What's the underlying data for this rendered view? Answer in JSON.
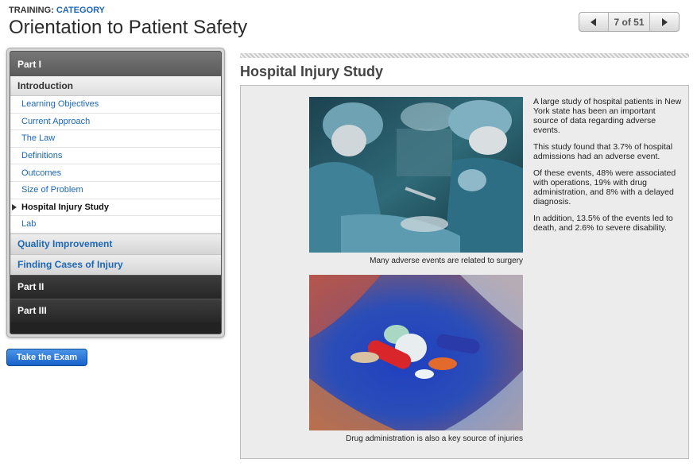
{
  "header": {
    "training_label": "TRAINING:",
    "category_label": "CATEGORY",
    "title": "Orientation to Patient Safety"
  },
  "pager": {
    "count": "7 of 51",
    "prev_icon": "triangle-left-icon",
    "next_icon": "triangle-right-icon"
  },
  "nav": {
    "part1": "Part I",
    "section": "Introduction",
    "items": [
      {
        "label": "Learning Objectives"
      },
      {
        "label": "Current Approach"
      },
      {
        "label": "The Law"
      },
      {
        "label": "Definitions"
      },
      {
        "label": "Outcomes"
      },
      {
        "label": "Size of Problem"
      },
      {
        "label": "Hospital Injury Study"
      },
      {
        "label": "Lab"
      }
    ],
    "current_index": 6,
    "subsections": [
      "Quality Improvement",
      "Finding Cases of Injury"
    ],
    "part2": "Part II",
    "part3": "Part III"
  },
  "exam_button": "Take the Exam",
  "content": {
    "title": "Hospital Injury Study",
    "caption1": "Many adverse events are related to surgery",
    "caption2": "Drug administration is also a key source of injuries",
    "paragraphs": [
      "A large study of hospital patients in New York state has been an important source of data regarding adverse events.",
      "This study found that 3.7% of hospital admissions had an adverse event.",
      "Of these events, 48% were associated with operations, 19% with drug administration, and 8% with a delayed diagnosis.",
      "In addition, 13.5% of the events led to death, and 2.6% to severe disability."
    ]
  },
  "colors": {
    "link_blue": "#1d67b5",
    "exam_button": "#1762c9",
    "nav_dark": "#262626"
  }
}
